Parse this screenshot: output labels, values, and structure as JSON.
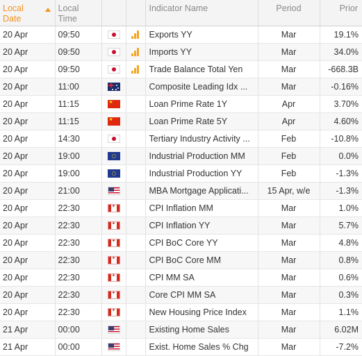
{
  "columns": {
    "local_date": "Local Date",
    "local_time": "Local Time",
    "indicator_name": "Indicator Name",
    "period": "Period",
    "prior": "Prior"
  },
  "colors": {
    "accent": "#f5911e",
    "importance_bars": "#f5a623"
  },
  "rows": [
    {
      "date": "20 Apr",
      "time": "09:50",
      "country": "jp-flag-icon",
      "importance": "high",
      "name": "Exports YY",
      "period": "Mar",
      "prior": "19.1%"
    },
    {
      "date": "20 Apr",
      "time": "09:50",
      "country": "jp-flag-icon",
      "importance": "high",
      "name": "Imports YY",
      "period": "Mar",
      "prior": "34.0%"
    },
    {
      "date": "20 Apr",
      "time": "09:50",
      "country": "jp-flag-icon",
      "importance": "high",
      "name": "Trade Balance Total Yen",
      "period": "Mar",
      "prior": "-668.3B"
    },
    {
      "date": "20 Apr",
      "time": "11:00",
      "country": "au-flag-icon",
      "importance": "none",
      "name": "Composite Leading Idx ...",
      "period": "Mar",
      "prior": "-0.16%"
    },
    {
      "date": "20 Apr",
      "time": "11:15",
      "country": "cn-flag-icon",
      "importance": "none",
      "name": "Loan Prime Rate 1Y",
      "period": "Apr",
      "prior": "3.70%"
    },
    {
      "date": "20 Apr",
      "time": "11:15",
      "country": "cn-flag-icon",
      "importance": "none",
      "name": "Loan Prime Rate 5Y",
      "period": "Apr",
      "prior": "4.60%"
    },
    {
      "date": "20 Apr",
      "time": "14:30",
      "country": "jp-flag-icon",
      "importance": "none",
      "name": "Tertiary Industry Activity ...",
      "period": "Feb",
      "prior": "-10.8%"
    },
    {
      "date": "20 Apr",
      "time": "19:00",
      "country": "eu-flag-icon",
      "importance": "none",
      "name": "Industrial Production MM",
      "period": "Feb",
      "prior": "0.0%"
    },
    {
      "date": "20 Apr",
      "time": "19:00",
      "country": "eu-flag-icon",
      "importance": "none",
      "name": "Industrial Production YY",
      "period": "Feb",
      "prior": "-1.3%"
    },
    {
      "date": "20 Apr",
      "time": "21:00",
      "country": "us-flag-icon",
      "importance": "none",
      "name": "MBA Mortgage Applicati...",
      "period": "15 Apr, w/e",
      "prior": "-1.3%"
    },
    {
      "date": "20 Apr",
      "time": "22:30",
      "country": "ca-flag-icon",
      "importance": "none",
      "name": "CPI Inflation MM",
      "period": "Mar",
      "prior": "1.0%"
    },
    {
      "date": "20 Apr",
      "time": "22:30",
      "country": "ca-flag-icon",
      "importance": "none",
      "name": "CPI Inflation YY",
      "period": "Mar",
      "prior": "5.7%"
    },
    {
      "date": "20 Apr",
      "time": "22:30",
      "country": "ca-flag-icon",
      "importance": "none",
      "name": "CPI BoC Core YY",
      "period": "Mar",
      "prior": "4.8%"
    },
    {
      "date": "20 Apr",
      "time": "22:30",
      "country": "ca-flag-icon",
      "importance": "none",
      "name": "CPI BoC Core MM",
      "period": "Mar",
      "prior": "0.8%"
    },
    {
      "date": "20 Apr",
      "time": "22:30",
      "country": "ca-flag-icon",
      "importance": "none",
      "name": "CPI MM SA",
      "period": "Mar",
      "prior": "0.6%"
    },
    {
      "date": "20 Apr",
      "time": "22:30",
      "country": "ca-flag-icon",
      "importance": "none",
      "name": "Core CPI MM SA",
      "period": "Mar",
      "prior": "0.3%"
    },
    {
      "date": "20 Apr",
      "time": "22:30",
      "country": "ca-flag-icon",
      "importance": "none",
      "name": "New Housing Price Index",
      "period": "Mar",
      "prior": "1.1%"
    },
    {
      "date": "21 Apr",
      "time": "00:00",
      "country": "us-flag-icon",
      "importance": "none",
      "name": "Existing Home Sales",
      "period": "Mar",
      "prior": "6.02M"
    },
    {
      "date": "21 Apr",
      "time": "00:00",
      "country": "us-flag-icon",
      "importance": "none",
      "name": "Exist. Home Sales % Chg",
      "period": "Mar",
      "prior": "-7.2%"
    }
  ]
}
